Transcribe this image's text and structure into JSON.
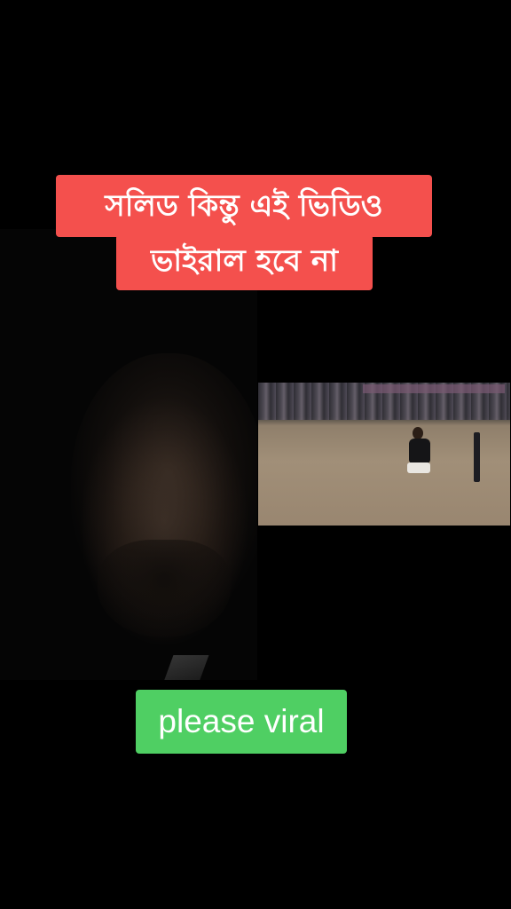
{
  "captions": {
    "top_line_1": "সলিড কিন্তু এই ভিডিও",
    "top_line_2": "ভাইরাল হবে না",
    "bottom": "please viral"
  },
  "colors": {
    "background": "#000000",
    "caption_red": "#f4504d",
    "caption_green": "#4fcf63",
    "caption_text": "#ffffff"
  },
  "media": {
    "left_panel": "front-camera-selfie-video",
    "right_panel": "cricket-field-video-clip"
  }
}
